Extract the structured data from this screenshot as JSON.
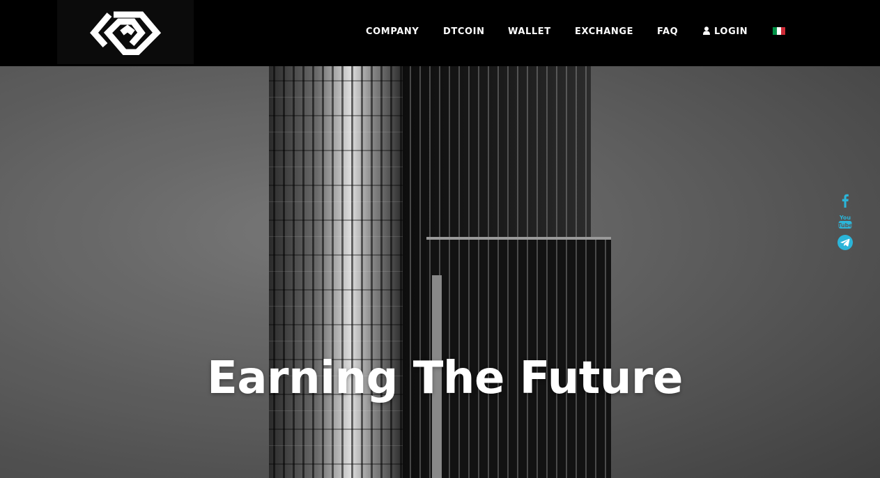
{
  "header": {
    "logo_name": "diamond-logo",
    "nav": [
      {
        "label": "COMPANY"
      },
      {
        "label": "DTCOIN"
      },
      {
        "label": "WALLET"
      },
      {
        "label": "EXCHANGE"
      },
      {
        "label": "FAQ"
      },
      {
        "label": "LOGIN",
        "icon": "user-icon"
      }
    ],
    "language_flag": "italy-flag",
    "flag_colors": [
      "#009246",
      "#ffffff",
      "#ce2b37"
    ]
  },
  "hero": {
    "headline": "Earning The Future",
    "background": "grayscale skyscraper photo"
  },
  "social": [
    {
      "icon": "facebook-icon",
      "label": "f"
    },
    {
      "icon": "youtube-icon",
      "label_top": "You",
      "label_bottom": "Tube"
    },
    {
      "icon": "telegram-icon"
    }
  ],
  "colors": {
    "header_bg": "#000000",
    "nav_text": "#ffffff",
    "social_accent": "#2bb5d9"
  }
}
